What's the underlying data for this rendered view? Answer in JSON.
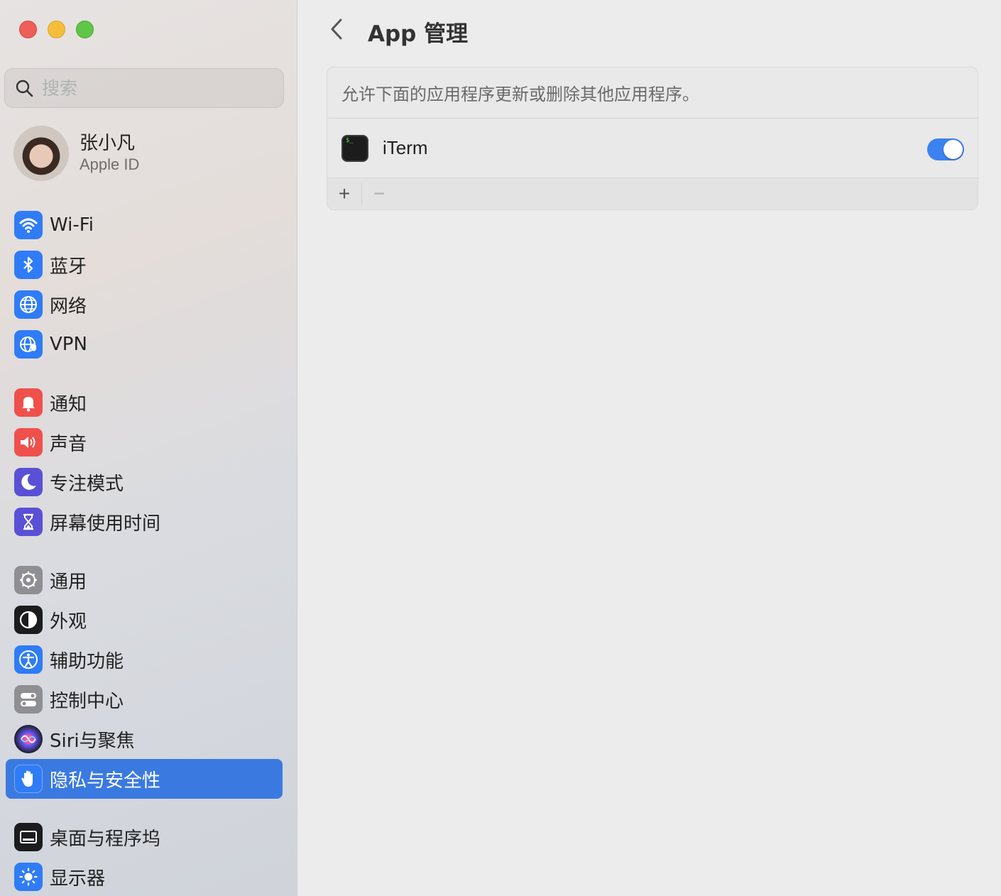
{
  "window": {
    "title": "App 管理"
  },
  "search": {
    "placeholder": "搜索"
  },
  "account": {
    "name": "张小凡",
    "subtitle": "Apple ID"
  },
  "sidebar": {
    "items": [
      {
        "label": "Wi-Fi",
        "icon": "wifi-icon",
        "color": "#2f7cf6"
      },
      {
        "label": "蓝牙",
        "icon": "bluetooth-icon",
        "color": "#2f7cf6"
      },
      {
        "label": "网络",
        "icon": "globe-icon",
        "color": "#2f7cf6"
      },
      {
        "label": "VPN",
        "icon": "vpn-globe-icon",
        "color": "#2f7cf6"
      },
      {
        "label": "通知",
        "icon": "bell-icon",
        "color": "#f0504c"
      },
      {
        "label": "声音",
        "icon": "speaker-icon",
        "color": "#f0504c"
      },
      {
        "label": "专注模式",
        "icon": "moon-icon",
        "color": "#5a50d6"
      },
      {
        "label": "屏幕使用时间",
        "icon": "hourglass-icon",
        "color": "#5a50d6"
      },
      {
        "label": "通用",
        "icon": "gear-icon",
        "color": "#8e8e93"
      },
      {
        "label": "外观",
        "icon": "appearance-icon",
        "color": "#1c1c1e"
      },
      {
        "label": "辅助功能",
        "icon": "accessibility-icon",
        "color": "#2f7cf6"
      },
      {
        "label": "控制中心",
        "icon": "control-center-icon",
        "color": "#8e8e93"
      },
      {
        "label": "Siri与聚焦",
        "icon": "siri-icon",
        "color": "#333"
      },
      {
        "label": "隐私与安全性",
        "icon": "hand-icon",
        "color": "#2f7cf6",
        "active": true
      },
      {
        "label": "桌面与程序坞",
        "icon": "dock-icon",
        "color": "#1c1c1e"
      },
      {
        "label": "显示器",
        "icon": "sun-icon",
        "color": "#2f7cf6"
      }
    ]
  },
  "main": {
    "title": "App 管理",
    "description": "允许下面的应用程序更新或删除其他应用程序。",
    "apps": [
      {
        "name": "iTerm",
        "enabled": true
      }
    ],
    "add_label": "+",
    "remove_label": "−"
  }
}
